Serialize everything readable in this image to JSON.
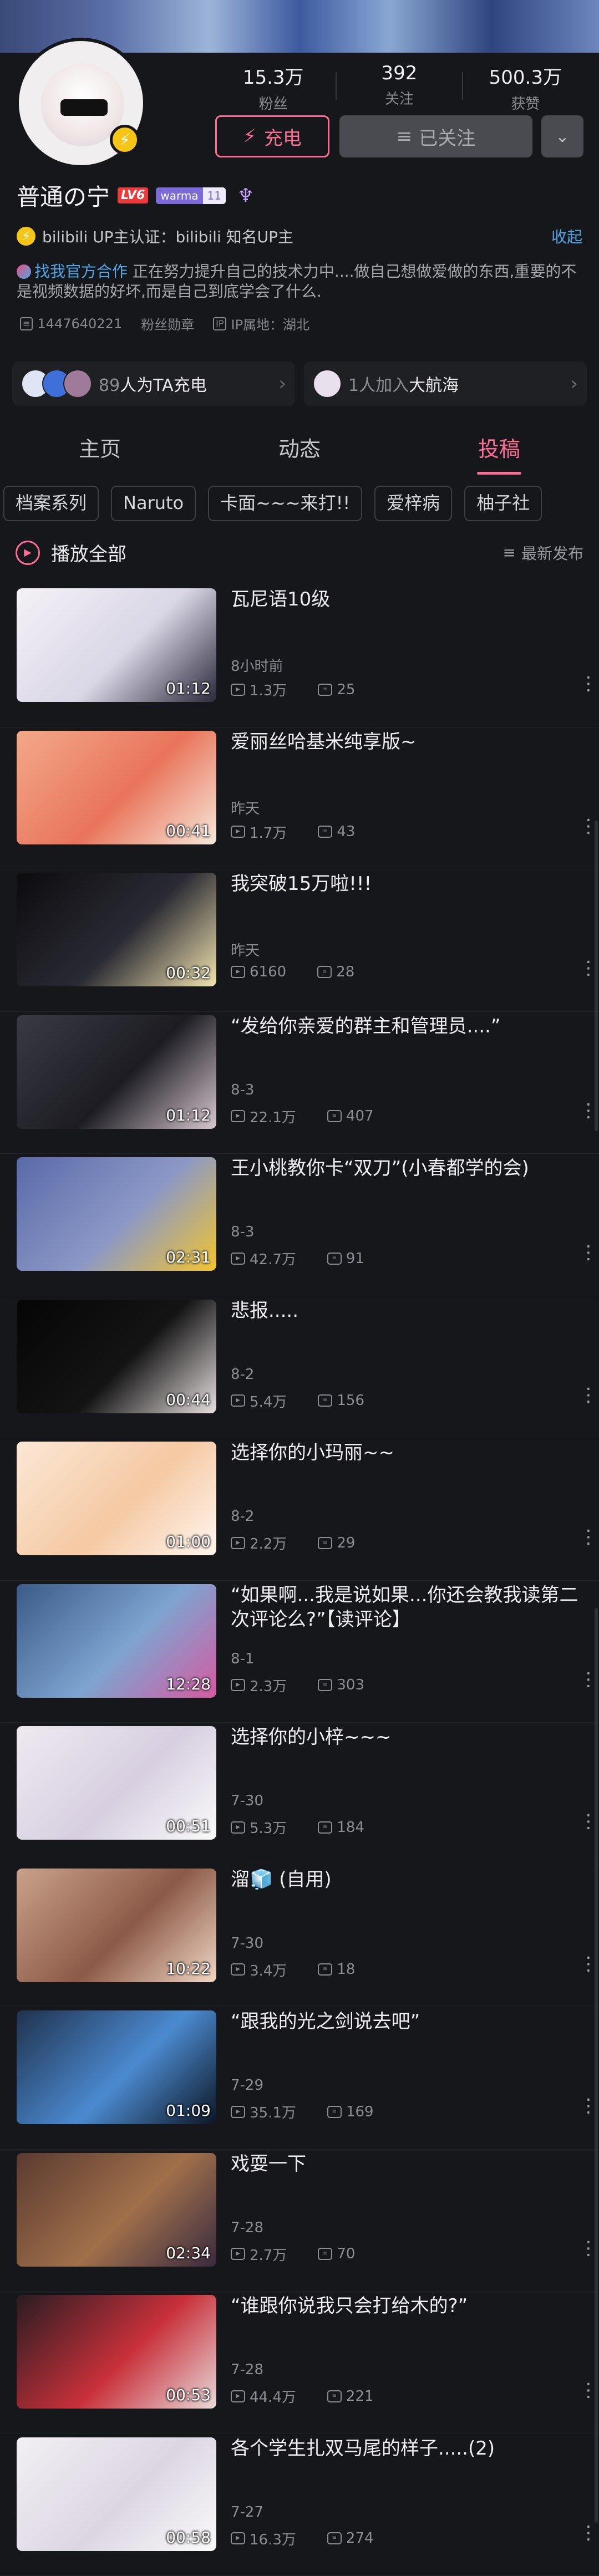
{
  "profile": {
    "stats": [
      {
        "value": "15.3万",
        "label": "粉丝"
      },
      {
        "value": "392",
        "label": "关注"
      },
      {
        "value": "500.3万",
        "label": "获赞"
      }
    ],
    "charge_label": "充电",
    "follow_label": "已关注",
    "username": "普通の宁",
    "level": "LV6",
    "medal_name": "warma",
    "medal_level": "11",
    "cert": "bilibili UP主认证：bilibili 知名UP主",
    "collapse_label": "收起",
    "bio_link": "找我官方合作",
    "bio_text": " 正在努力提升自己的技术力中....做自己想做爱做的东西,重要的不是视频数据的好坏,而是自己到底学会了什么.",
    "uid": "1447640221",
    "fan_medal": "粉丝勋章",
    "ip_label": "IP属地：湖北",
    "charge_card": {
      "count": "89",
      "text": "人为TA充电"
    },
    "guard_card": {
      "count": "1人加入",
      "highlight": "大航海"
    }
  },
  "tabs": [
    {
      "label": "主页"
    },
    {
      "label": "动态"
    },
    {
      "label": "投稿"
    }
  ],
  "chips": [
    "档案系列",
    "Naruto",
    "卡面~~~来打!!",
    "爱梓病",
    "柚子社"
  ],
  "playall": {
    "label": "播放全部",
    "sort": "最新发布"
  },
  "videos": [
    {
      "title": "瓦尼语10级",
      "date": "8小时前",
      "views": "1.3万",
      "danmaku": "25",
      "duration": "01:12",
      "colors": [
        "#f4f2f6",
        "#d9d6e6",
        "#2b2a3a"
      ]
    },
    {
      "title": "爱丽丝哈基米纯享版~",
      "date": "昨天",
      "views": "1.7万",
      "danmaku": "43",
      "duration": "00:41",
      "colors": [
        "#f3a98a",
        "#e9745a",
        "#f7e8da"
      ]
    },
    {
      "title": "我突破15万啦!!!",
      "date": "昨天",
      "views": "6160",
      "danmaku": "28",
      "duration": "00:32",
      "colors": [
        "#0c0c0f",
        "#2a2a33",
        "#f1e3b0"
      ]
    },
    {
      "title": "“发给你亲爱的群主和管理员....”",
      "date": "8-3",
      "views": "22.1万",
      "danmaku": "407",
      "duration": "01:12",
      "colors": [
        "#3a3a44",
        "#1c1c22",
        "#d8c8d0"
      ]
    },
    {
      "title": "王小桃教你卡“双刀”(小春都学的会)",
      "date": "8-3",
      "views": "42.7万",
      "danmaku": "91",
      "duration": "02:31",
      "colors": [
        "#5a6aa8",
        "#8b98c6",
        "#f3c430"
      ]
    },
    {
      "title": "悲报.....",
      "date": "8-2",
      "views": "5.4万",
      "danmaku": "156",
      "duration": "00:44",
      "colors": [
        "#050505",
        "#141414",
        "#e8e0e0"
      ]
    },
    {
      "title": "选择你的小玛丽~~",
      "date": "8-2",
      "views": "2.2万",
      "danmaku": "29",
      "duration": "01:00",
      "colors": [
        "#fbe8d6",
        "#f5c9a3",
        "#fff6ee"
      ]
    },
    {
      "title": "“如果啊...我是说如果...你还会教我读第二次评论么?”【读评论】",
      "date": "8-1",
      "views": "2.3万",
      "danmaku": "303",
      "duration": "12:28",
      "colors": [
        "#3b5a88",
        "#7ea4d0",
        "#d65aa0"
      ]
    },
    {
      "title": "选择你的小梓~~~",
      "date": "7-30",
      "views": "5.3万",
      "danmaku": "184",
      "duration": "00:51",
      "colors": [
        "#eeeaf0",
        "#d7cfe0",
        "#fafafa"
      ]
    },
    {
      "title": "溜🧊 (自用)",
      "date": "7-30",
      "views": "3.4万",
      "danmaku": "18",
      "duration": "10:22",
      "colors": [
        "#c9a28a",
        "#8c5a48",
        "#f0d6c4"
      ]
    },
    {
      "title": "“跟我的光之剑说去吧”",
      "date": "7-29",
      "views": "35.1万",
      "danmaku": "169",
      "duration": "01:09",
      "colors": [
        "#20324e",
        "#4b8ad0",
        "#0d1624"
      ]
    },
    {
      "title": "戏耍一下",
      "date": "7-28",
      "views": "2.7万",
      "danmaku": "70",
      "duration": "02:34",
      "colors": [
        "#5a3a30",
        "#a0704a",
        "#3a2a40"
      ]
    },
    {
      "title": "“谁跟你说我只会打给木的?”",
      "date": "7-28",
      "views": "44.4万",
      "danmaku": "221",
      "duration": "00:53",
      "colors": [
        "#2a1c22",
        "#c8303a",
        "#e8dada"
      ]
    },
    {
      "title": "各个学生扎双马尾的样子.....(2)",
      "date": "7-27",
      "views": "16.3万",
      "danmaku": "274",
      "duration": "00:58",
      "colors": [
        "#f2f0f4",
        "#dcd6e2",
        "#fafafa"
      ]
    }
  ],
  "accent": "#fb6d93"
}
